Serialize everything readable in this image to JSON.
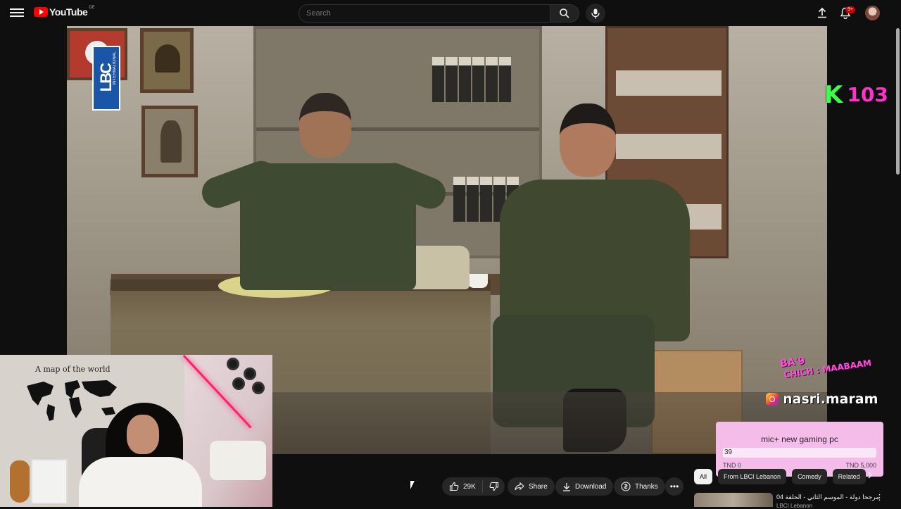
{
  "header": {
    "logo_text": "YouTube",
    "region_code": "DE",
    "search_placeholder": "Search",
    "notification_count": "9+",
    "icons": [
      "menu-icon",
      "search-icon",
      "mic-icon",
      "upload-icon",
      "bell-icon"
    ]
  },
  "video": {
    "channel_watermark": "LBC",
    "channel_watermark_sub": "INTERNATIONAL",
    "station_logo_letter": "K",
    "station_logo_number": "103"
  },
  "stream_overlay": {
    "tagline_line1": "BA'9",
    "tagline_line2": "CHICH : MAABAAM",
    "social_handle": "nasri.maram",
    "webcam_poster_text": "A map of the world"
  },
  "donation_goal": {
    "title": "mic+ new gaming pc",
    "current_value": "39",
    "min_label": "TND 0",
    "max_label": "TND 5,000",
    "progress_fraction": 0.0078,
    "bar_color": "#ffffff",
    "panel_color": "#f4bde9"
  },
  "actions": {
    "like_count": "29K",
    "share_label": "Share",
    "download_label": "Download",
    "thanks_label": "Thanks",
    "more_label": "•••"
  },
  "chips": {
    "items": [
      "All",
      "From LBCI Lebanon",
      "Comedy",
      "Related"
    ],
    "active_index": 0
  },
  "recommendation": {
    "title": "04 مرجحا دولة - الموسم الثاني - الحلقة",
    "channel": "LBCI Lebanon"
  },
  "colors": {
    "background": "#0f0f0f",
    "accent_red": "#ff0000",
    "chip_bg": "#272727",
    "k103_green": "#3bff4a",
    "k103_pink": "#ff33cc"
  }
}
